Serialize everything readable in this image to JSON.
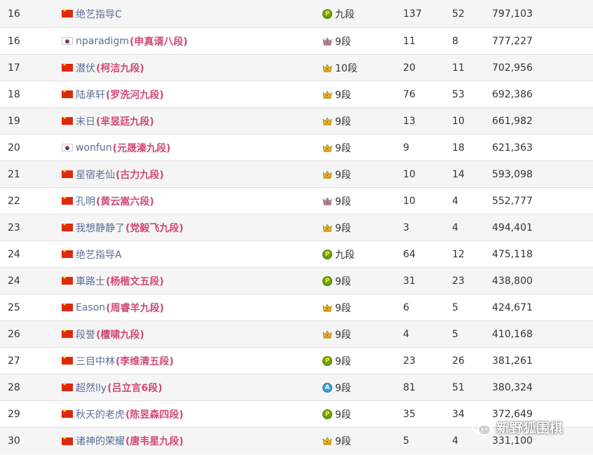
{
  "rows": [
    {
      "rank": "16",
      "flag": "cn",
      "username": "绝艺指导C",
      "realname": "",
      "badge": "p",
      "level": "九段",
      "games": "137",
      "wins": "52",
      "score": "797,103"
    },
    {
      "rank": "16",
      "flag": "kr",
      "username": "nparadigm",
      "realname": "(申真谞八段)",
      "badge": "crown-purple",
      "level": "9段",
      "games": "11",
      "wins": "8",
      "score": "777,227"
    },
    {
      "rank": "17",
      "flag": "cn",
      "username": "潜伏",
      "realname": "(柯洁九段)",
      "badge": "crown-gold",
      "level": "10段",
      "games": "20",
      "wins": "11",
      "score": "702,956"
    },
    {
      "rank": "18",
      "flag": "cn",
      "username": "陆承轩",
      "realname": "(罗洗河九段)",
      "badge": "crown-gold",
      "level": "9段",
      "games": "76",
      "wins": "53",
      "score": "692,386"
    },
    {
      "rank": "19",
      "flag": "cn",
      "username": "末日",
      "realname": "(芈昱廷九段)",
      "badge": "crown-gold",
      "level": "9段",
      "games": "13",
      "wins": "10",
      "score": "661,982"
    },
    {
      "rank": "20",
      "flag": "kr",
      "username": "wonfun",
      "realname": "(元晟溱九段)",
      "badge": "crown-gold",
      "level": "9段",
      "games": "9",
      "wins": "18",
      "score": "621,363"
    },
    {
      "rank": "21",
      "flag": "cn",
      "username": "星宿老仙",
      "realname": "(古力九段)",
      "badge": "crown-gold",
      "level": "9段",
      "games": "10",
      "wins": "14",
      "score": "593,098"
    },
    {
      "rank": "22",
      "flag": "cn",
      "username": "孔明",
      "realname": "(黄云嵩六段)",
      "badge": "crown-purple",
      "level": "9段",
      "games": "10",
      "wins": "4",
      "score": "552,777"
    },
    {
      "rank": "23",
      "flag": "cn",
      "username": "我想静静了",
      "realname": "(党毅飞九段)",
      "badge": "crown-gold",
      "level": "9段",
      "games": "3",
      "wins": "4",
      "score": "494,401"
    },
    {
      "rank": "24",
      "flag": "cn",
      "username": "绝艺指导A",
      "realname": "",
      "badge": "p",
      "level": "九段",
      "games": "64",
      "wins": "12",
      "score": "475,118"
    },
    {
      "rank": "24",
      "flag": "cn",
      "username": "車路士",
      "realname": "(杨楷文五段)",
      "badge": "p",
      "level": "9段",
      "games": "31",
      "wins": "23",
      "score": "438,800"
    },
    {
      "rank": "25",
      "flag": "cn",
      "username": "Eason",
      "realname": "(周睿羊九段)",
      "badge": "crown-gold",
      "level": "9段",
      "games": "6",
      "wins": "5",
      "score": "424,671"
    },
    {
      "rank": "26",
      "flag": "cn",
      "username": "段誉",
      "realname": "(檀啸九段)",
      "badge": "crown-gold",
      "level": "9段",
      "games": "4",
      "wins": "5",
      "score": "410,168"
    },
    {
      "rank": "27",
      "flag": "cn",
      "username": "三目中林",
      "realname": "(李维清五段)",
      "badge": "p",
      "level": "9段",
      "games": "23",
      "wins": "26",
      "score": "381,261"
    },
    {
      "rank": "28",
      "flag": "cn",
      "username": "超然lly",
      "realname": "(吕立言6段)",
      "badge": "a",
      "level": "9段",
      "games": "81",
      "wins": "51",
      "score": "380,324"
    },
    {
      "rank": "29",
      "flag": "cn",
      "username": "秋天的老虎",
      "realname": "(陈昱森四段)",
      "badge": "p",
      "level": "9段",
      "games": "35",
      "wins": "34",
      "score": "372,649"
    },
    {
      "rank": "30",
      "flag": "cn",
      "username": "诸神的荣耀",
      "realname": "(唐韦星九段)",
      "badge": "crown-gold",
      "level": "9段",
      "games": "5",
      "wins": "4",
      "score": "331,100"
    }
  ],
  "badge_glyphs": {
    "p": "P",
    "a": "A"
  },
  "colors": {
    "username": "#5a6e9a",
    "realname": "#d04a7a",
    "crown_gold": "#e6b422",
    "crown_purple": "#b57bbd",
    "row_alt": "#f5f5f5"
  },
  "watermark": {
    "text": "新野狐围棋",
    "icon": "wechat-icon"
  }
}
